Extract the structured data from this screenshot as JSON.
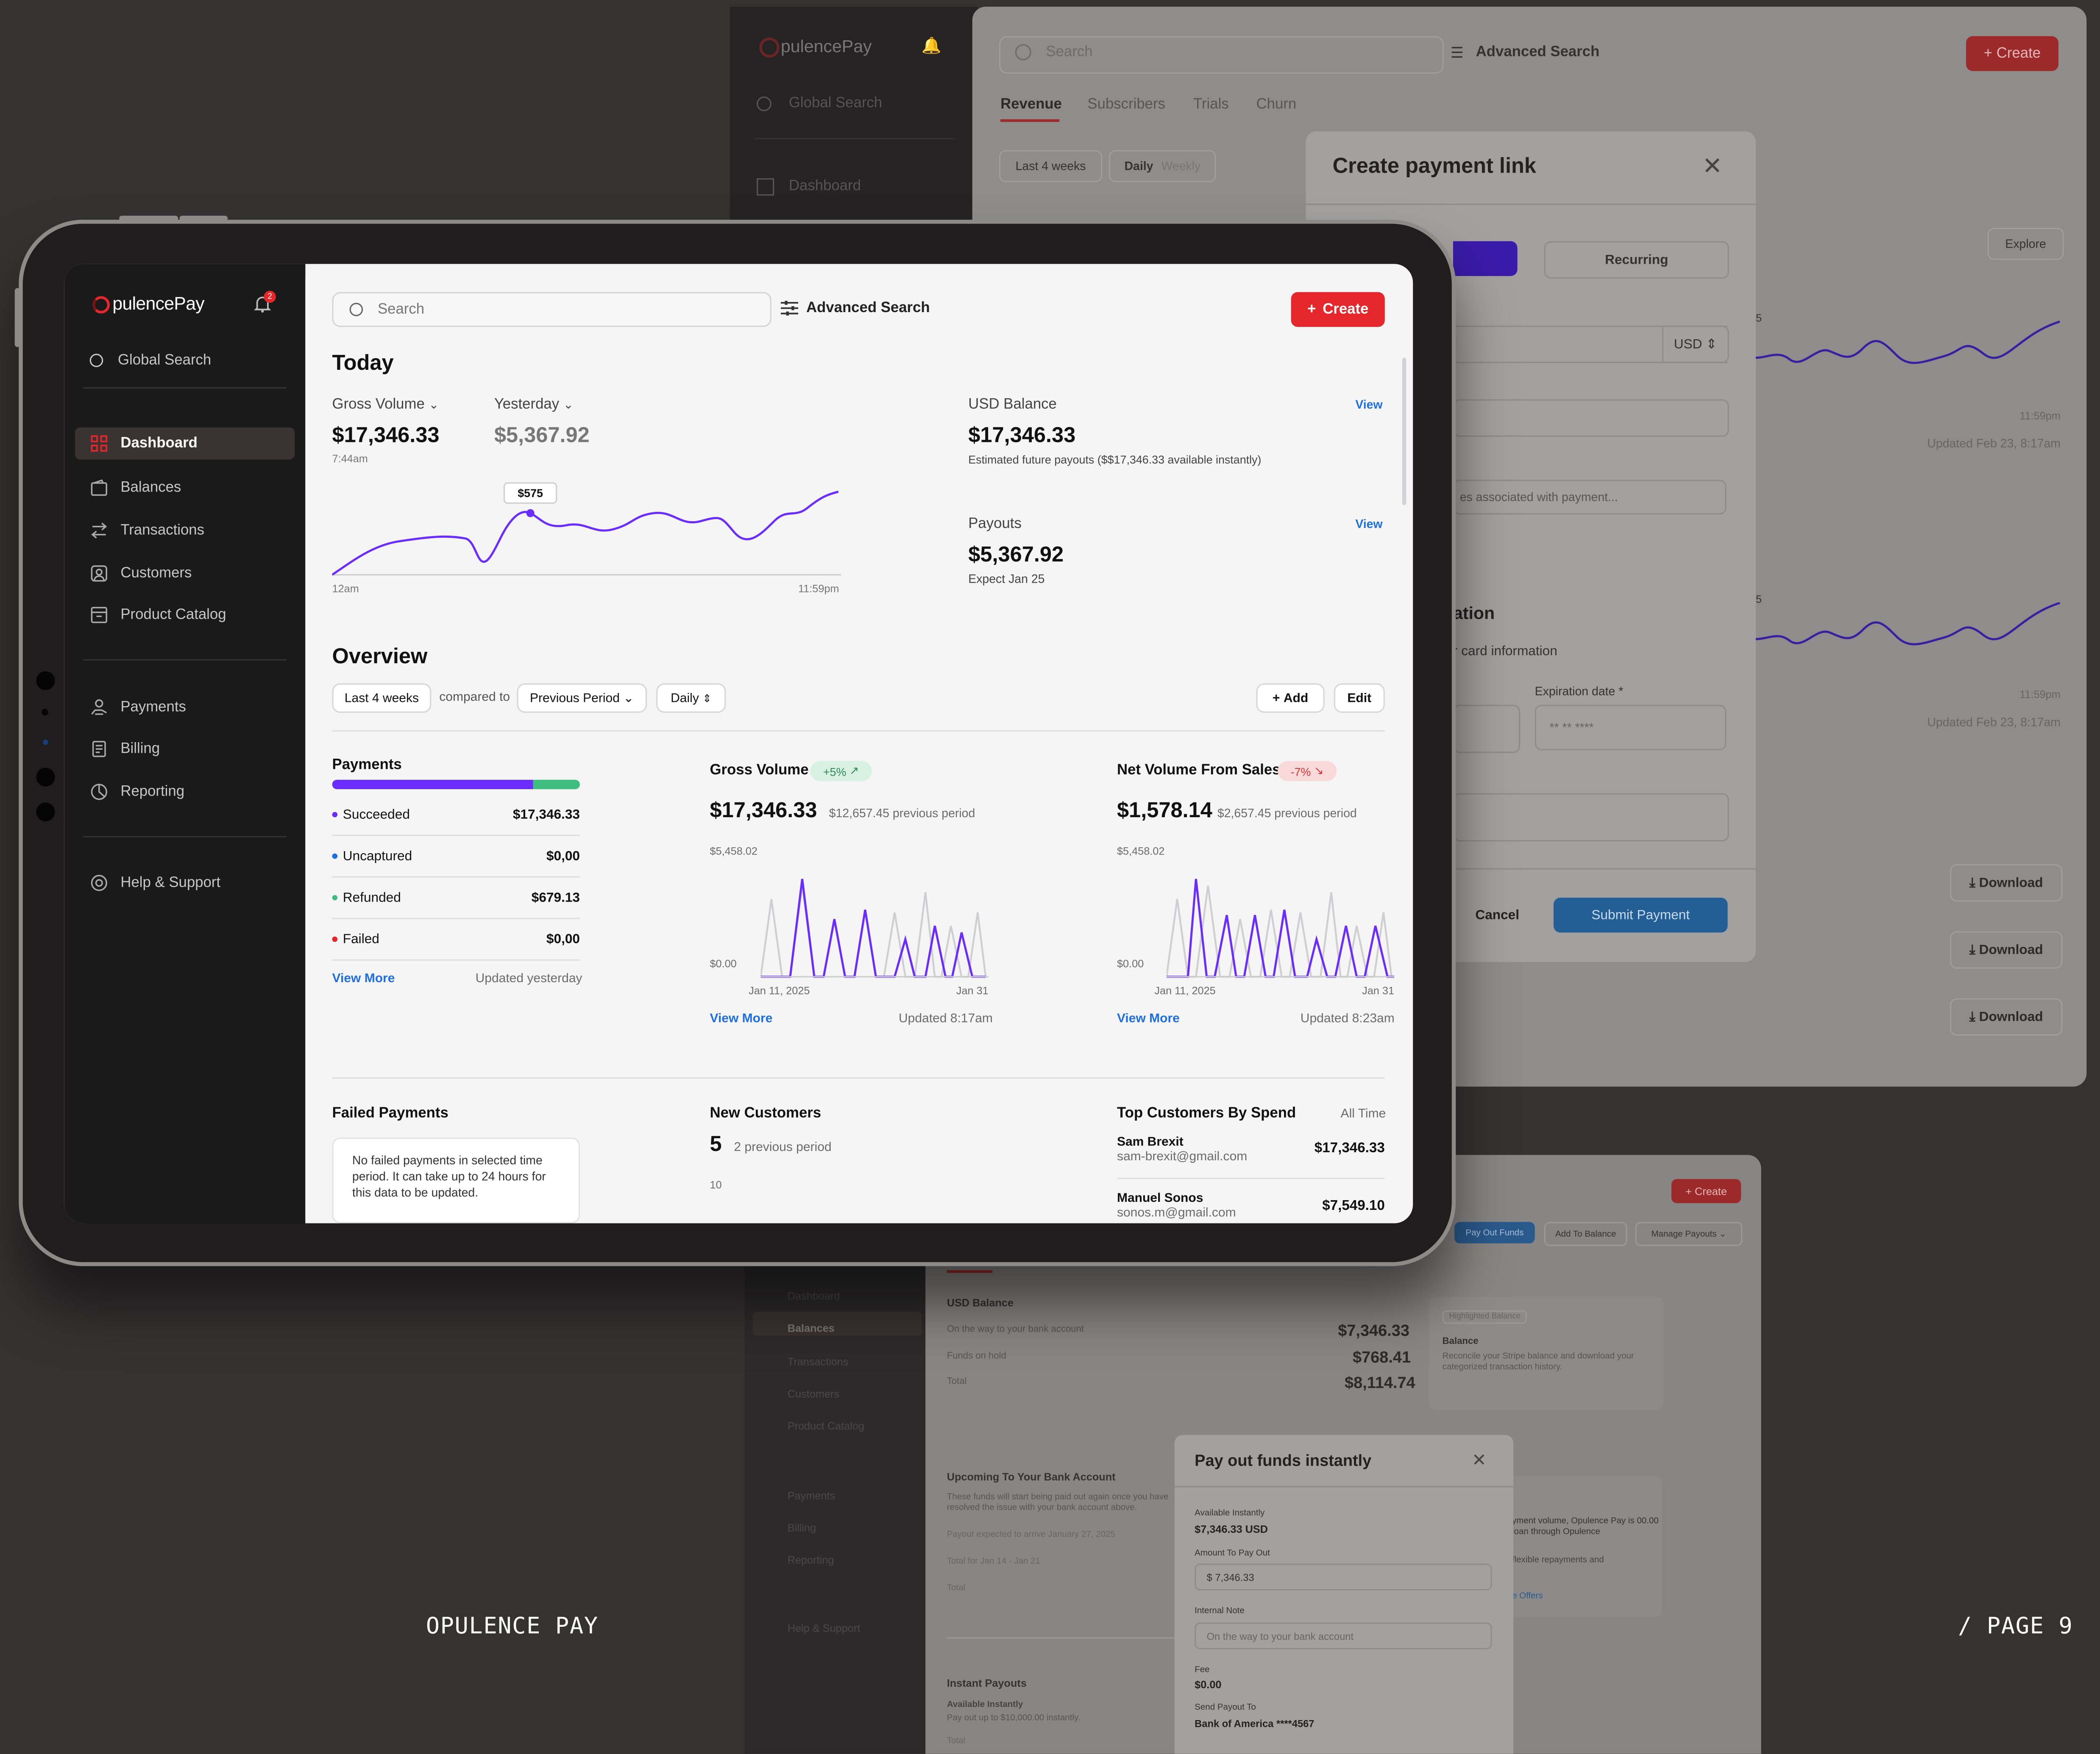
{
  "colors": {
    "accent": "#e5262b",
    "purple": "#6a2cff",
    "green": "#3fbf7f",
    "link": "#1f6fe0",
    "blue_button": "#1f73c9"
  },
  "brand": {
    "logo_text": "pulencePay",
    "logo_lettering": "OpulencePay",
    "footer_left": "OPULENCE PAY",
    "footer_right": "/ PAGE 9"
  },
  "sidebar": {
    "notifications_count": "2",
    "global_search": "Global Search",
    "items": [
      {
        "label": "Dashboard",
        "icon": "grid-icon"
      },
      {
        "label": "Balances",
        "icon": "wallet-icon"
      },
      {
        "label": "Transactions",
        "icon": "arrows-icon"
      },
      {
        "label": "Customers",
        "icon": "user-icon"
      },
      {
        "label": "Product Catalog",
        "icon": "catalog-icon"
      },
      {
        "label": "Payments",
        "icon": "coins-icon"
      },
      {
        "label": "Billing",
        "icon": "receipt-icon"
      },
      {
        "label": "Reporting",
        "icon": "chart-pie-icon"
      },
      {
        "label": "Help & Support",
        "icon": "lifebuoy-icon"
      }
    ]
  },
  "header": {
    "search_placeholder": "Search",
    "advanced_search": "Advanced Search",
    "create": "Create"
  },
  "today": {
    "title": "Today",
    "gross_volume_label": "Gross Volume",
    "gross_volume": "$17,346.33",
    "time": "7:44am",
    "yesterday_label": "Yesterday",
    "yesterday_value": "$5,367.92",
    "tooltip": "$575",
    "x_start": "12am",
    "x_end": "11:59pm",
    "usd_balance_label": "USD Balance",
    "usd_balance": "$17,346.33",
    "usd_note": "Estimated future payouts ($$17,346.33 available instantly)",
    "view": "View",
    "payouts_label": "Payouts",
    "payouts_value": "$5,367.92",
    "payouts_note": "Expect Jan 25"
  },
  "overview": {
    "title": "Overview",
    "range": "Last 4 weeks",
    "compared_to": "compared to",
    "period": "Previous Period",
    "interval": "Daily",
    "add": "Add",
    "edit": "Edit",
    "payments": {
      "title": "Payments",
      "rows": [
        {
          "label": "Succeeded",
          "value": "$17,346.33",
          "color": "#6a2cff"
        },
        {
          "label": "Uncaptured",
          "value": "$0,00",
          "color": "#1f6fe0"
        },
        {
          "label": "Refunded",
          "value": "$679.13",
          "color": "#3fbf7f"
        },
        {
          "label": "Failed",
          "value": "$0,00",
          "color": "#e5262b"
        }
      ],
      "bar_succeeded_fraction": 0.81,
      "view_more": "View More",
      "updated": "Updated yesterday"
    },
    "gross_volume": {
      "title": "Gross Volume",
      "badge": "+5%",
      "value": "$17,346.33",
      "previous": "$12,657.45 previous period",
      "y_top": "$5,458.02",
      "y_bottom": "$0.00",
      "x_start": "Jan 11, 2025",
      "x_end": "Jan 31",
      "view_more": "View More",
      "updated": "Updated 8:17am"
    },
    "net_volume": {
      "title": "Net Volume From Sales",
      "badge": "-7%",
      "value": "$1,578.14",
      "previous": "$2,657.45 previous period",
      "y_top": "$5,458.02",
      "y_bottom": "$0.00",
      "x_start": "Jan 11, 2025",
      "x_end": "Jan 31",
      "view_more": "View More",
      "updated": "Updated 8:23am"
    }
  },
  "lower": {
    "failed_title": "Failed Payments",
    "failed_note": "No failed payments in selected time period. It can take up to 24 hours for this data to be updated.",
    "new_customers_title": "New Customers",
    "new_customers_value": "5",
    "new_customers_prev": "2 previous period",
    "new_customers_axis": "10",
    "top_title": "Top Customers By Spend",
    "top_range": "All Time",
    "top": [
      {
        "name": "Sam Brexit",
        "email": "sam-brexit@gmail.com",
        "value": "$17,346.33"
      },
      {
        "name": "Manuel Sonos",
        "email": "sonos.m@gmail.com",
        "value": "$7,549.10"
      }
    ]
  },
  "bg_top": {
    "search": "Search",
    "advanced": "Advanced Search",
    "create": "Create",
    "tabs": [
      "Revenue",
      "Subscribers",
      "Trials",
      "Churn"
    ],
    "filter1": "Last 4 weeks",
    "filter2a": "Daily",
    "filter2b": "Weekly",
    "explore": "Explore",
    "times": [
      "11:59pm",
      "11:59pm"
    ],
    "updated": [
      "Updated Feb 23, 8:17am",
      "Updated Feb 23, 8:17am"
    ],
    "axis5": [
      "5",
      "5"
    ],
    "downloads": [
      "Download",
      "Download",
      "Download"
    ],
    "sidebar_logo": "pulencePay",
    "sidebar_search": "Global Search",
    "sidebar_dashboard": "Dashboard"
  },
  "modal_link": {
    "title": "Create payment link",
    "recurring": "Recurring",
    "currency": "USD",
    "desc_placeholder": "es associated with payment...",
    "section": "ation",
    "card_info": "r card information",
    "expiration": "Expiration date *",
    "expiration_placeholder": "** ** ****",
    "cancel": "Cancel",
    "submit": "Submit Payment"
  },
  "bg_bottom": {
    "create": "Create",
    "pay_out": "Pay Out Funds",
    "add_balance": "Add To Balance",
    "manage": "Manage Payouts",
    "nav": [
      "Dashboard",
      "Balances",
      "Transactions",
      "Customers",
      "Product Catalog",
      "Payments",
      "Billing",
      "Reporting",
      "Help & Support"
    ],
    "usd_title": "USD Balance",
    "usd_rows": [
      {
        "label": "On the way to your bank account",
        "value": "$7,346.33"
      },
      {
        "label": "Funds on hold",
        "value": "$768.41"
      },
      {
        "label": "Total",
        "value": "$8,114.74"
      }
    ],
    "side_badge": "Highlighted Balance",
    "side_title": "Balance",
    "side_note": "Reconcile your Stripe balance and download your categorized transaction history.",
    "upcoming_title": "Upcoming To Your Bank Account",
    "upcoming_note": "These funds will start being paid out again once you have resolved the issue with your bank account above.",
    "payout_expected": "Payout expected to arrive January 27, 2025",
    "total_for": "Total for Jan 14 - Jan 21",
    "total": "Total",
    "instant_title": "Instant Payouts",
    "instant_available": "Available Instantly",
    "instant_note": "Pay out up to $10,000.00 instantly.",
    "instant_total": "Total",
    "loan_note": "yment volume, Opulence Pay is 00.00 loan through Opulence",
    "loan_note2": "flexible repayments and",
    "offers": "e Offers"
  },
  "modal_payout": {
    "title": "Pay out funds instantly",
    "available_label": "Available Instantly",
    "available_value": "$7,346.33 USD",
    "amount_label": "Amount To Pay Out",
    "amount_value": "$ 7,346.33",
    "note_label": "Internal Note",
    "note_placeholder": "On the way to your bank account",
    "fee_label": "Fee",
    "fee_value": "$0.00",
    "send_label": "Send Payout To",
    "send_value": "Bank of America ****4567"
  }
}
